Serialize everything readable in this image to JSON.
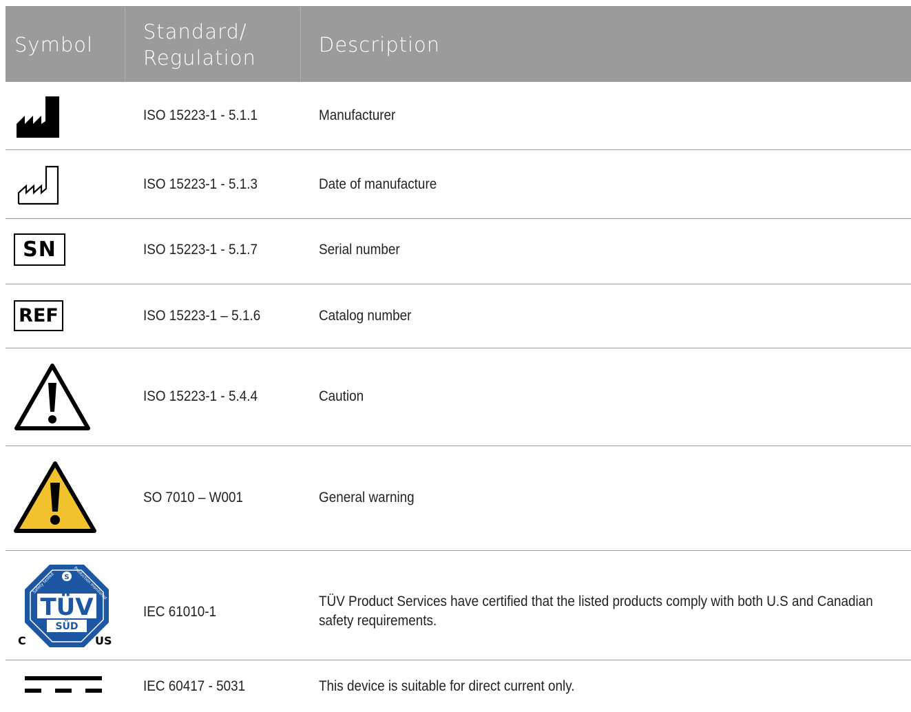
{
  "table": {
    "headers": {
      "symbol": "Symbol",
      "standard": "Standard/ Regulation",
      "description": "Description"
    },
    "rows": [
      {
        "icon": "manufacturer-icon",
        "standard": "ISO 15223-1 - 5.1.1",
        "description": "Manufacturer"
      },
      {
        "icon": "date-of-manufacture-icon",
        "standard": "ISO 15223-1 - 5.1.3",
        "description": "Date of manufacture"
      },
      {
        "icon": "serial-number-icon",
        "symbol_text": "SN",
        "standard": "ISO 15223-1 - 5.1.7",
        "description": "Serial number"
      },
      {
        "icon": "catalog-number-icon",
        "symbol_text": "REF",
        "standard": "ISO 15223-1 – 5.1.6",
        "description": "Catalog number"
      },
      {
        "icon": "caution-icon",
        "standard": "ISO 15223-1 - 5.4.4",
        "description": "Caution"
      },
      {
        "icon": "general-warning-icon",
        "standard": "SO 7010 – W001",
        "description": "General warning"
      },
      {
        "icon": "tuv-sud-certification-icon",
        "symbol_text": {
          "brand": "TÜV",
          "sub": "SÜD",
          "left": "C",
          "right": "US",
          "top_left": "Safety tested",
          "top_right": "Production monitored"
        },
        "standard": "IEC 61010-1",
        "description": "TÜV Product Services have certified that the listed products comply with both U.S and Canadian safety requirements."
      },
      {
        "icon": "direct-current-icon",
        "standard": "IEC 60417 - 5031",
        "description": "This device is suitable for direct current only."
      }
    ]
  },
  "colors": {
    "header_bg": "#9b9b9b",
    "header_text": "#ffffff",
    "warning_yellow": "#f2c12e",
    "tuv_blue": "#1d57a3"
  }
}
